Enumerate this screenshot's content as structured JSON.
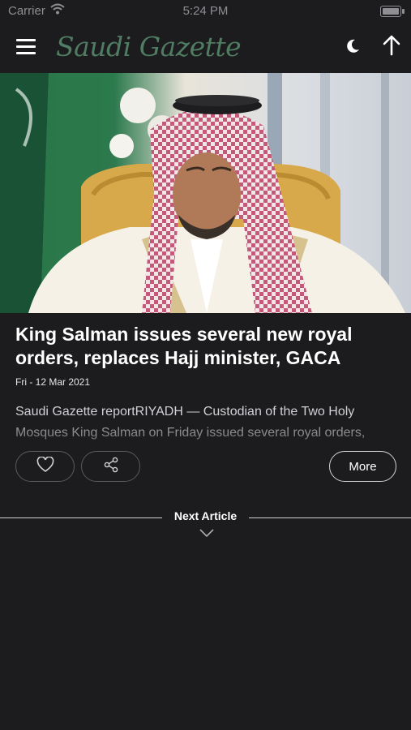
{
  "status_bar": {
    "carrier": "Carrier",
    "time": "5:24 PM"
  },
  "header": {
    "logo_text": "Saudi Gazette",
    "brand_color": "#4f7c62"
  },
  "article": {
    "title": "King Salman issues several new royal orders, replaces Hajj minister, GACA",
    "date": "Fri - 12 Mar 2021",
    "excerpt": "Saudi Gazette reportRIYADH — Custodian of the Two Holy Mosques King Salman on Friday issued several royal orders,"
  },
  "actions": {
    "more_label": "More"
  },
  "next_article": {
    "label": "Next Article"
  },
  "icons": [
    "wifi-icon",
    "battery-icon",
    "menu-icon",
    "moon-icon",
    "arrow-up-icon",
    "heart-icon",
    "share-icon",
    "chevron-down-icon"
  ]
}
